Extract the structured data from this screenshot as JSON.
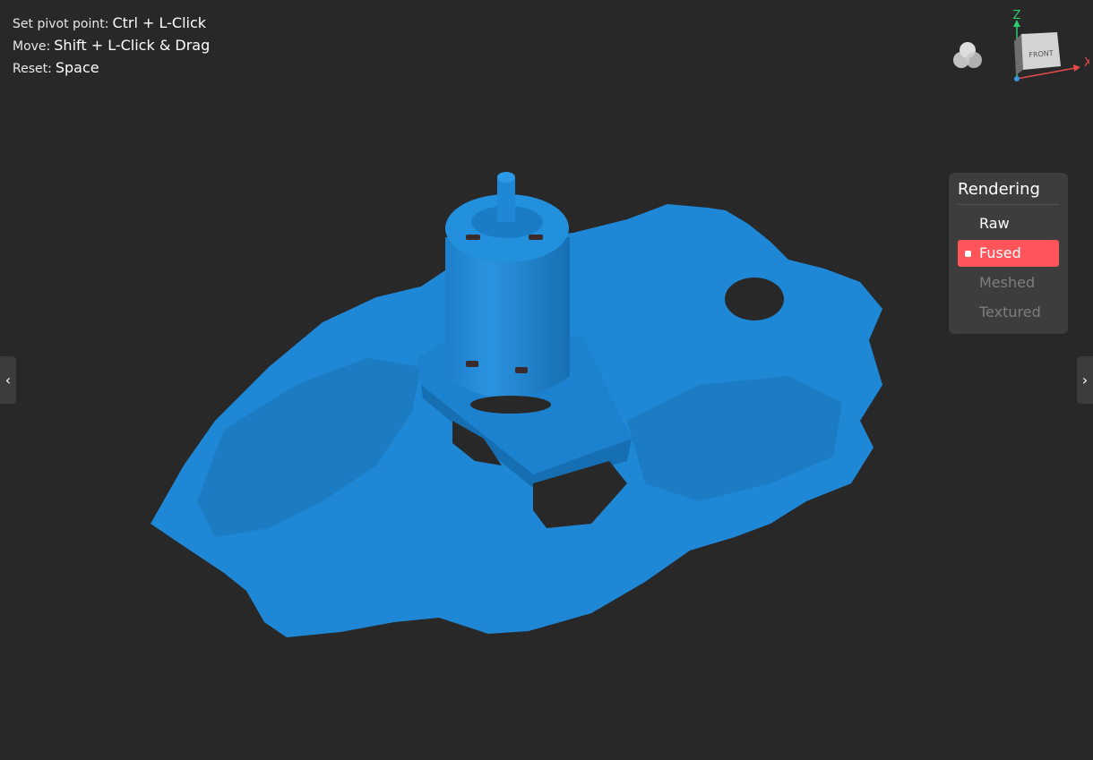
{
  "hints": [
    {
      "label": "Set pivot point:",
      "key": "Ctrl + L-Click"
    },
    {
      "label": "Move:",
      "key": "Shift + L-Click & Drag"
    },
    {
      "label": "Reset:",
      "key": "Space"
    }
  ],
  "gizmo": {
    "face_label": "FRONT",
    "axis_z": "Z",
    "axis_x": "X",
    "colors": {
      "x": "#e94b4b",
      "z": "#2ecc71",
      "y": "#3498db"
    }
  },
  "rendering": {
    "title": "Rendering",
    "options": [
      {
        "label": "Raw",
        "state": "normal"
      },
      {
        "label": "Fused",
        "state": "active"
      },
      {
        "label": "Meshed",
        "state": "disabled"
      },
      {
        "label": "Textured",
        "state": "disabled"
      }
    ]
  },
  "nav": {
    "prev_glyph": "‹",
    "next_glyph": "›"
  },
  "colors": {
    "background": "#282828",
    "model": "#1f88d6",
    "accent": "#ff5459",
    "panel": "#3d3d3d"
  }
}
